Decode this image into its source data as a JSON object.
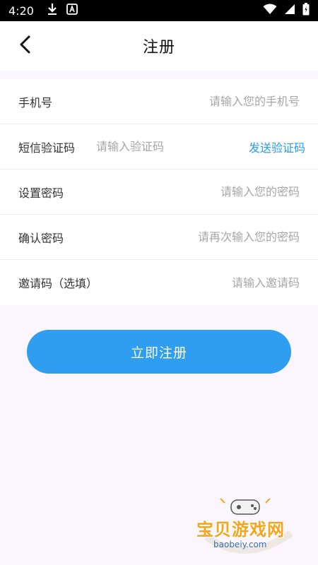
{
  "status_bar": {
    "time": "4:20",
    "icons": [
      "download-icon",
      "a-badge-icon",
      "wifi-icon",
      "signal-icon",
      "battery-icon"
    ]
  },
  "nav": {
    "title": "注册",
    "back_icon": "chevron-left-icon"
  },
  "form": {
    "phone": {
      "label": "手机号",
      "placeholder": "请输入您的手机号"
    },
    "sms_code": {
      "label": "短信验证码",
      "placeholder": "请输入验证码",
      "send_label": "发送验证码"
    },
    "password": {
      "label": "设置密码",
      "placeholder": "请输入您的密码"
    },
    "confirm_password": {
      "label": "确认密码",
      "placeholder": "请再次输入您的密码"
    },
    "invite_code": {
      "label": "邀请码（选填）",
      "placeholder": "请输入邀请码"
    }
  },
  "submit": {
    "label": "立即注册"
  },
  "watermark": {
    "text": "宝贝游戏网",
    "url": "baobeiy.com"
  },
  "colors": {
    "accent": "#2f9ef0",
    "link": "#2b9be8",
    "background": "#fbf6fd"
  }
}
